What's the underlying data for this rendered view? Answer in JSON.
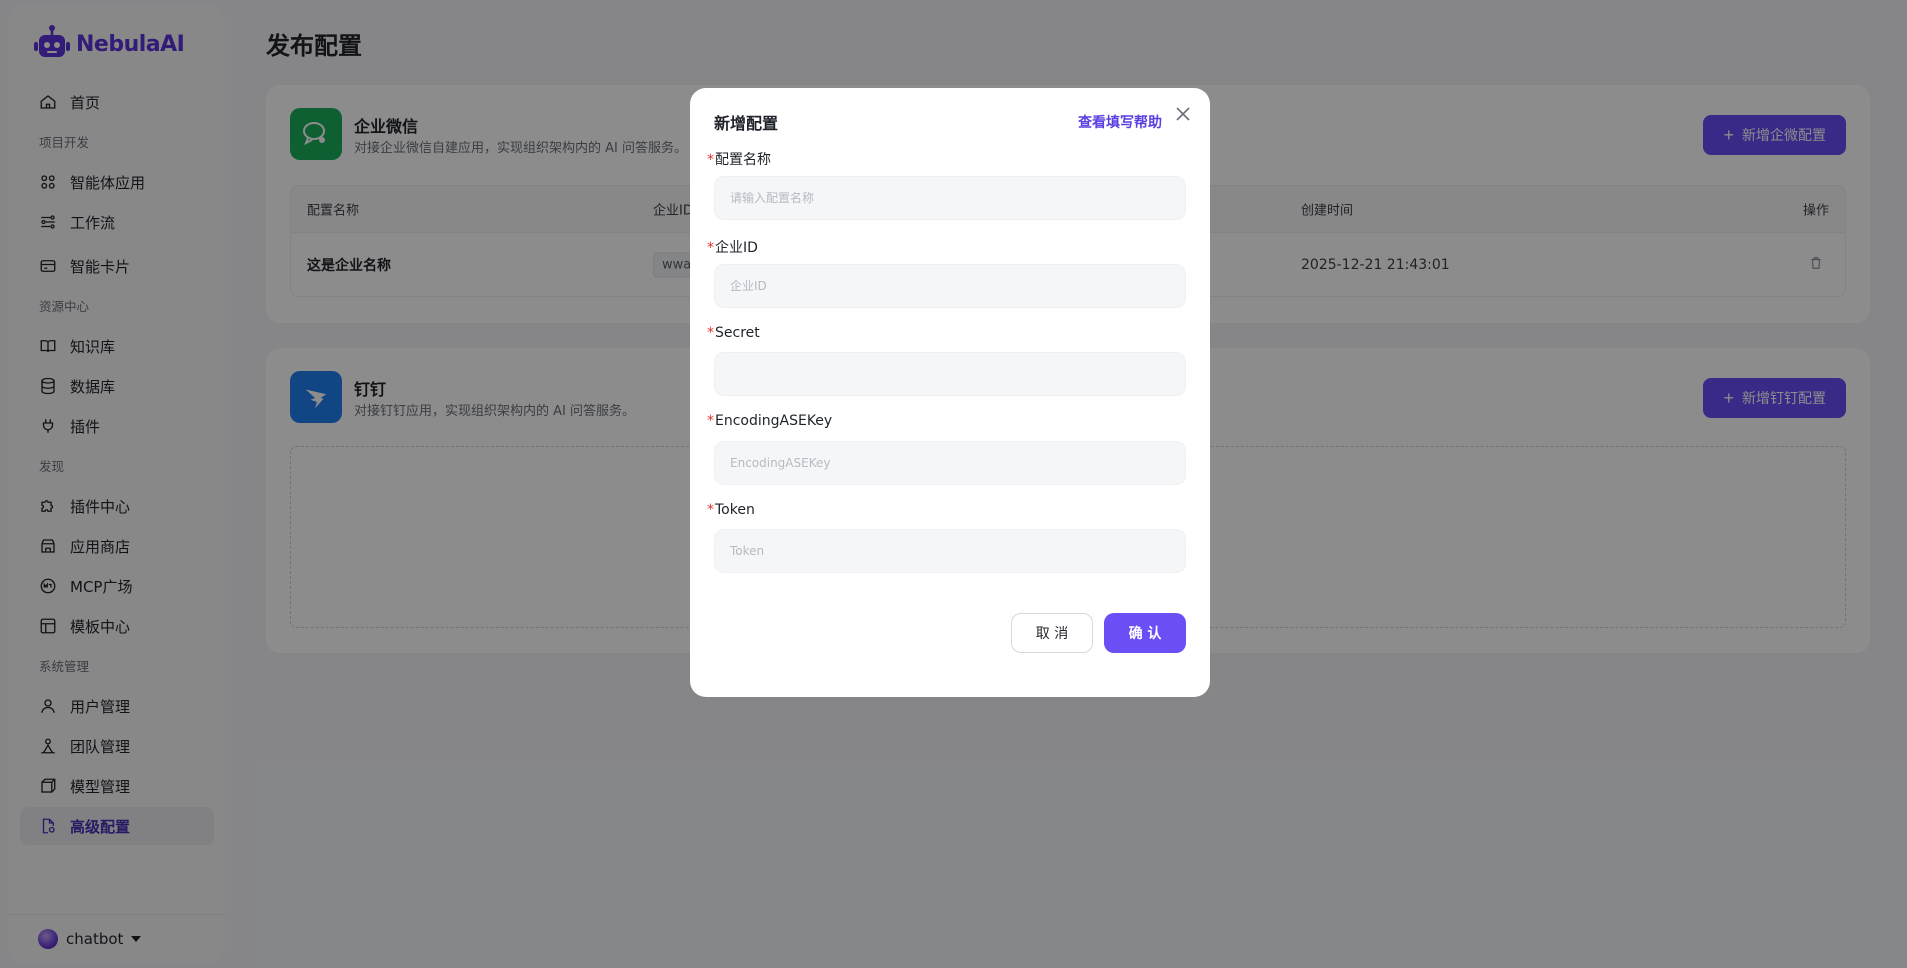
{
  "brand": {
    "name": "NebulaAI",
    "color": "#5b34d9"
  },
  "sidebar": {
    "home": {
      "label": "首页",
      "icon": "home-icon"
    },
    "sections": [
      {
        "title": "项目开发"
      },
      {
        "title": "资源中心"
      },
      {
        "title": "发现"
      },
      {
        "title": "系统管理"
      }
    ],
    "items": [
      {
        "label": "智能体应用",
        "icon": "grid-icon"
      },
      {
        "label": "工作流",
        "icon": "workflow-icon"
      },
      {
        "label": "智能卡片",
        "icon": "card-icon"
      },
      {
        "label": "知识库",
        "icon": "book-icon"
      },
      {
        "label": "数据库",
        "icon": "database-icon"
      },
      {
        "label": "插件",
        "icon": "plug-icon"
      },
      {
        "label": "插件中心",
        "icon": "puzzle-icon"
      },
      {
        "label": "应用商店",
        "icon": "store-icon"
      },
      {
        "label": "MCP广场",
        "icon": "mcp-icon"
      },
      {
        "label": "模板中心",
        "icon": "template-icon"
      },
      {
        "label": "用户管理",
        "icon": "user-icon"
      },
      {
        "label": "团队管理",
        "icon": "team-icon"
      },
      {
        "label": "模型管理",
        "icon": "cube-icon"
      },
      {
        "label": "高级配置",
        "icon": "settings-file-icon",
        "active": true
      }
    ],
    "user": {
      "name": "chatbot"
    }
  },
  "page": {
    "title": "发布配置"
  },
  "wecom": {
    "title": "企业微信",
    "desc": "对接企业微信自建应用，实现组织架构内的 AI 问答服务。",
    "add_button": "新增企微配置",
    "table": {
      "columns": [
        "配置名称",
        "企业ID",
        "创建时间",
        "操作"
      ],
      "rows": [
        {
          "name": "这是企业名称",
          "corp_id": "wwa",
          "created": "2025-12-21 21:43:01"
        }
      ]
    }
  },
  "dingtalk": {
    "title": "钉钉",
    "desc": "对接钉钉应用，实现组织架构内的 AI 问答服务。",
    "add_button": "新增钉钉配置"
  },
  "modal": {
    "title": "新增配置",
    "help_link": "查看填写帮助",
    "fields": [
      {
        "label": "配置名称",
        "placeholder": "请输入配置名称",
        "value": ""
      },
      {
        "label": "企业ID",
        "placeholder": "企业ID",
        "value": ""
      },
      {
        "label": "Secret",
        "placeholder": "",
        "value": ""
      },
      {
        "label": "EncodingASEKey",
        "placeholder": "EncodingASEKey",
        "value": ""
      },
      {
        "label": "Token",
        "placeholder": "Token",
        "value": ""
      }
    ],
    "cancel": "取 消",
    "confirm": "确 认"
  },
  "colors": {
    "accent": "#6b4ef6",
    "required": "#e5322d",
    "wecom_green": "#1aad5b",
    "dingtalk_blue": "#1f7fef"
  }
}
